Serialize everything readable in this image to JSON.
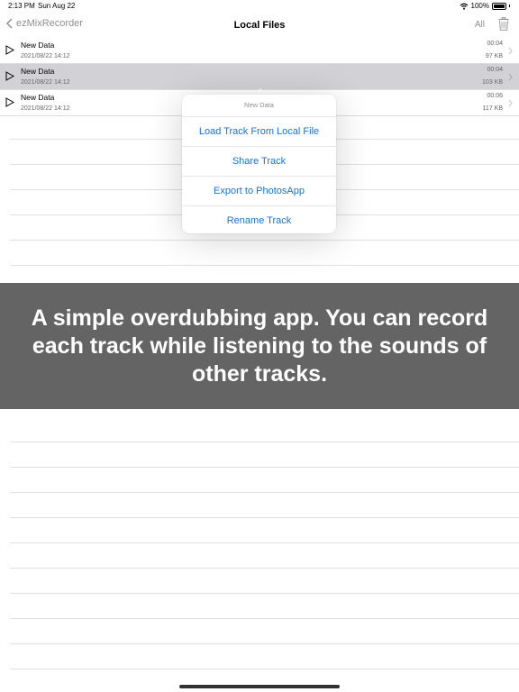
{
  "status_bar": {
    "time": "2:13 PM",
    "date": "Sun Aug 22",
    "battery": "100%"
  },
  "nav": {
    "back_label": "ezMixRecorder",
    "title": "Local Files",
    "all_label": "All"
  },
  "files": [
    {
      "name": "New Data",
      "date": "2021/08/22 14:12",
      "duration": "00:04",
      "size": "97 KB",
      "selected": false
    },
    {
      "name": "New Data",
      "date": "2021/08/22 14:12",
      "duration": "00:04",
      "size": "103 KB",
      "selected": true
    },
    {
      "name": "New Data",
      "date": "2021/08/22 14:12",
      "duration": "00:06",
      "size": "117 KB",
      "selected": false
    }
  ],
  "popover": {
    "title": "New Data",
    "items": [
      {
        "label": "Load Track From Local File"
      },
      {
        "label": "Share Track"
      },
      {
        "label": "Export to PhotosApp"
      },
      {
        "label": "Rename Track"
      }
    ]
  },
  "banner": {
    "caption": "A simple overdubbing app. You can record each track while listening to the sounds of other tracks."
  },
  "colors": {
    "accent": "#1a73c9",
    "banner_bg": "#646464",
    "selected_row": "#d1d1d6"
  }
}
